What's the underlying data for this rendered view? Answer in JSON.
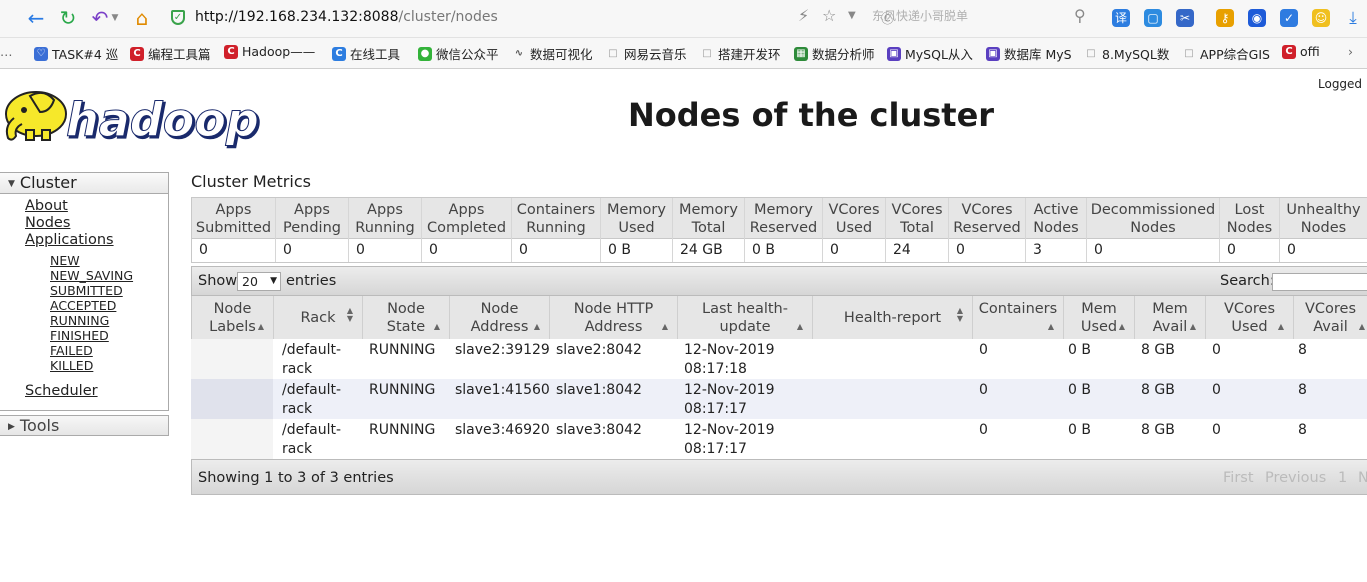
{
  "browser": {
    "url_host": "http://192.168.234.132:8088",
    "url_path": "/cluster/nodes",
    "search_hint": "东风快递小哥脱单"
  },
  "bookmarks": [
    {
      "label": "TASK#4 巡",
      "icon": "heart-icon",
      "color": "#3b6fd6"
    },
    {
      "label": "编程工具篇",
      "icon": "c-icon",
      "color": "#d0202a"
    },
    {
      "label": "Hadoop——",
      "icon": "c-icon",
      "color": "#d0202a"
    },
    {
      "label": "在线工具",
      "icon": "c-icon",
      "color": "#2d7de0"
    },
    {
      "label": "微信公众平",
      "icon": "wechat-icon",
      "color": "#33b33a"
    },
    {
      "label": "数据可视化",
      "icon": "chart-icon",
      "color": "#555555"
    },
    {
      "label": "网易云音乐",
      "icon": "page-icon",
      "color": "#999999"
    },
    {
      "label": "搭建开发环",
      "icon": "page-icon",
      "color": "#999999"
    },
    {
      "label": "数据分析师",
      "icon": "book-icon",
      "color": "#2e8b3a"
    },
    {
      "label": "MySQL从入",
      "icon": "chat-icon",
      "color": "#5a3fc0"
    },
    {
      "label": "数据库 MyS",
      "icon": "chat-icon",
      "color": "#5a3fc0"
    },
    {
      "label": "8.MySQL数",
      "icon": "page-icon",
      "color": "#999999"
    },
    {
      "label": "APP综合GIS",
      "icon": "page-icon",
      "color": "#999999"
    },
    {
      "label": "offi",
      "icon": "c-icon",
      "color": "#d0202a"
    }
  ],
  "page": {
    "logged_text": "Logged",
    "title": "Nodes of the cluster",
    "logo_text": "hadoop"
  },
  "sidebar": {
    "cluster_label": "Cluster",
    "about": "About",
    "nodes": "Nodes",
    "applications": "Applications",
    "app_states": [
      "NEW",
      "NEW_SAVING",
      "SUBMITTED",
      "ACCEPTED",
      "RUNNING",
      "FINISHED",
      "FAILED",
      "KILLED"
    ],
    "scheduler": "Scheduler",
    "tools_label": "Tools"
  },
  "metrics": {
    "title": "Cluster Metrics",
    "columns": [
      {
        "h1": "Apps",
        "h2": "Submitted",
        "value": "0",
        "link": false
      },
      {
        "h1": "Apps",
        "h2": "Pending",
        "value": "0",
        "link": false
      },
      {
        "h1": "Apps",
        "h2": "Running",
        "value": "0",
        "link": false
      },
      {
        "h1": "Apps",
        "h2": "Completed",
        "value": "0",
        "link": false
      },
      {
        "h1": "Containers",
        "h2": "Running",
        "value": "0",
        "link": false
      },
      {
        "h1": "Memory",
        "h2": "Used",
        "value": "0 B",
        "link": false
      },
      {
        "h1": "Memory",
        "h2": "Total",
        "value": "24 GB",
        "link": false
      },
      {
        "h1": "Memory",
        "h2": "Reserved",
        "value": "0 B",
        "link": false
      },
      {
        "h1": "VCores",
        "h2": "Used",
        "value": "0",
        "link": false
      },
      {
        "h1": "VCores",
        "h2": "Total",
        "value": "24",
        "link": false
      },
      {
        "h1": "VCores",
        "h2": "Reserved",
        "value": "0",
        "link": false
      },
      {
        "h1": "Active",
        "h2": "Nodes",
        "value": "3",
        "link": true
      },
      {
        "h1": "Decommissioned",
        "h2": "Nodes",
        "value": "0",
        "link": true
      },
      {
        "h1": "Lost",
        "h2": "Nodes",
        "value": "0",
        "link": true
      },
      {
        "h1": "Unhealthy",
        "h2": "Nodes",
        "value": "0",
        "link": true
      }
    ]
  },
  "table": {
    "show_label": "Show",
    "page_size": "20",
    "entries_label": "entries",
    "search_label": "Search:",
    "columns": [
      {
        "h1": "Node",
        "h2": "Labels"
      },
      {
        "h1": "Rack",
        "h2": ""
      },
      {
        "h1": "Node",
        "h2": "State"
      },
      {
        "h1": "Node",
        "h2": "Address"
      },
      {
        "h1": "Node HTTP",
        "h2": "Address"
      },
      {
        "h1": "Last health-",
        "h2": "update"
      },
      {
        "h1": "Health-report",
        "h2": ""
      },
      {
        "h1": "Containers",
        "h2": ""
      },
      {
        "h1": "Mem",
        "h2": "Used"
      },
      {
        "h1": "Mem",
        "h2": "Avail"
      },
      {
        "h1": "VCores",
        "h2": "Used"
      },
      {
        "h1": "VCores",
        "h2": "Avail"
      }
    ],
    "rows": [
      {
        "rack_1": "/default-",
        "rack_2": "rack",
        "state": "RUNNING",
        "address": "slave2:39129",
        "http": "slave2:8042",
        "update_1": "12-Nov-2019",
        "update_2": "08:17:18",
        "containers": "0",
        "mem_used": "0 B",
        "mem_avail": "8 GB",
        "vcores_used": "0",
        "vcores_avail": "8"
      },
      {
        "rack_1": "/default-",
        "rack_2": "rack",
        "state": "RUNNING",
        "address": "slave1:41560",
        "http": "slave1:8042",
        "update_1": "12-Nov-2019",
        "update_2": "08:17:17",
        "containers": "0",
        "mem_used": "0 B",
        "mem_avail": "8 GB",
        "vcores_used": "0",
        "vcores_avail": "8"
      },
      {
        "rack_1": "/default-",
        "rack_2": "rack",
        "state": "RUNNING",
        "address": "slave3:46920",
        "http": "slave3:8042",
        "update_1": "12-Nov-2019",
        "update_2": "08:17:17",
        "containers": "0",
        "mem_used": "0 B",
        "mem_avail": "8 GB",
        "vcores_used": "0",
        "vcores_avail": "8"
      }
    ],
    "info": "Showing 1 to 3 of 3 entries",
    "paging": {
      "first": "First",
      "previous": "Previous",
      "page": "1",
      "next": "N"
    }
  }
}
